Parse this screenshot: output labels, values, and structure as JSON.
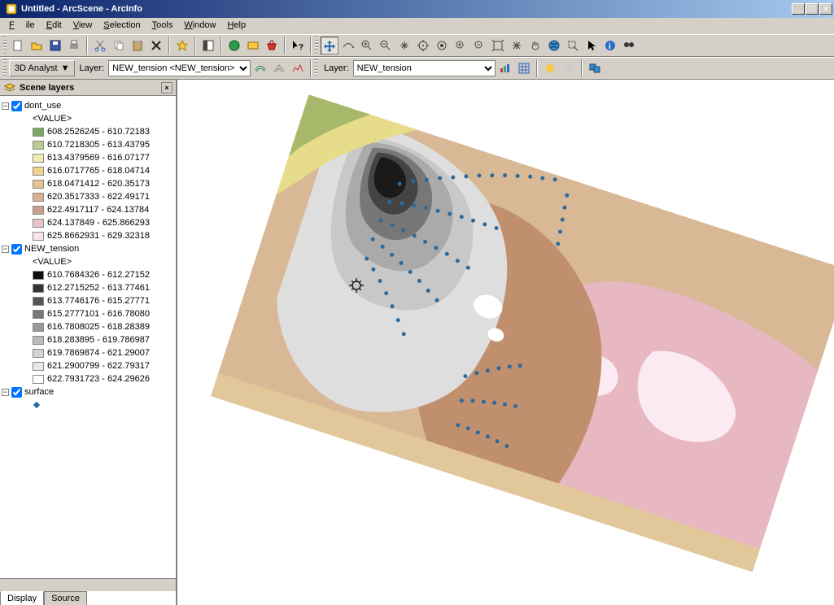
{
  "window": {
    "title": "Untitled - ArcScene - ArcInfo"
  },
  "menu": {
    "file": "File",
    "edit": "Edit",
    "view": "View",
    "selection": "Selection",
    "tools": "Tools",
    "window": "Window",
    "help": "Help"
  },
  "toolbar2": {
    "analyst_label": "3D Analyst",
    "layer_label": "Layer:",
    "layer_value": "NEW_tension <NEW_tension>",
    "layer2_label": "Layer:",
    "layer2_value": "NEW_tension"
  },
  "toc": {
    "header": "Scene layers",
    "layer1": {
      "name": "dont_use",
      "value_hdr": "<VALUE>",
      "classes": [
        {
          "label": "608.2526245 - 610.72183",
          "color": "#7aa962"
        },
        {
          "label": "610.7218305 - 613.43795",
          "color": "#b9cd8f"
        },
        {
          "label": "613.4379569 - 616.07177",
          "color": "#f2ebb2"
        },
        {
          "label": "616.0717765 - 618.04714",
          "color": "#f2d48a"
        },
        {
          "label": "618.0471412 - 620.35173",
          "color": "#e6c491"
        },
        {
          "label": "620.3517333 - 622.49171",
          "color": "#d9b18f"
        },
        {
          "label": "622.4917117 - 624.13784",
          "color": "#caa088"
        },
        {
          "label": "624.137849 - 625.866293",
          "color": "#e6c3c6"
        },
        {
          "label": "625.8662931 - 629.32318",
          "color": "#f6e4e6"
        }
      ]
    },
    "layer2": {
      "name": "NEW_tension",
      "value_hdr": "<VALUE>",
      "classes": [
        {
          "label": "610.7684326 - 612.27152",
          "color": "#0f0f0f"
        },
        {
          "label": "612.2715252 - 613.77461",
          "color": "#333333"
        },
        {
          "label": "613.7746176 - 615.27771",
          "color": "#555555"
        },
        {
          "label": "615.2777101 - 616.78080",
          "color": "#777777"
        },
        {
          "label": "616.7808025 - 618.28389",
          "color": "#999999"
        },
        {
          "label": "618.283895 - 619.786987",
          "color": "#bbbbbb"
        },
        {
          "label": "619.7869874 - 621.29007",
          "color": "#d4d4d4"
        },
        {
          "label": "621.2900799 - 622.79317",
          "color": "#e8e8e8"
        },
        {
          "label": "622.7931723 - 624.29626",
          "color": "#ffffff"
        }
      ]
    },
    "layer3": {
      "name": "surface",
      "symbol_color": "#2a6a9c"
    },
    "tabs": {
      "display": "Display",
      "source": "Source"
    }
  },
  "icons": {
    "new": "new",
    "open": "open",
    "save": "save",
    "print": "print",
    "cut": "cut",
    "copy": "copy",
    "paste": "paste",
    "delete": "delete",
    "undo": "undo",
    "add": "add-data",
    "refresh": "refresh",
    "globe": "globe",
    "zoom": "zoom",
    "help": "help",
    "find": "find"
  }
}
